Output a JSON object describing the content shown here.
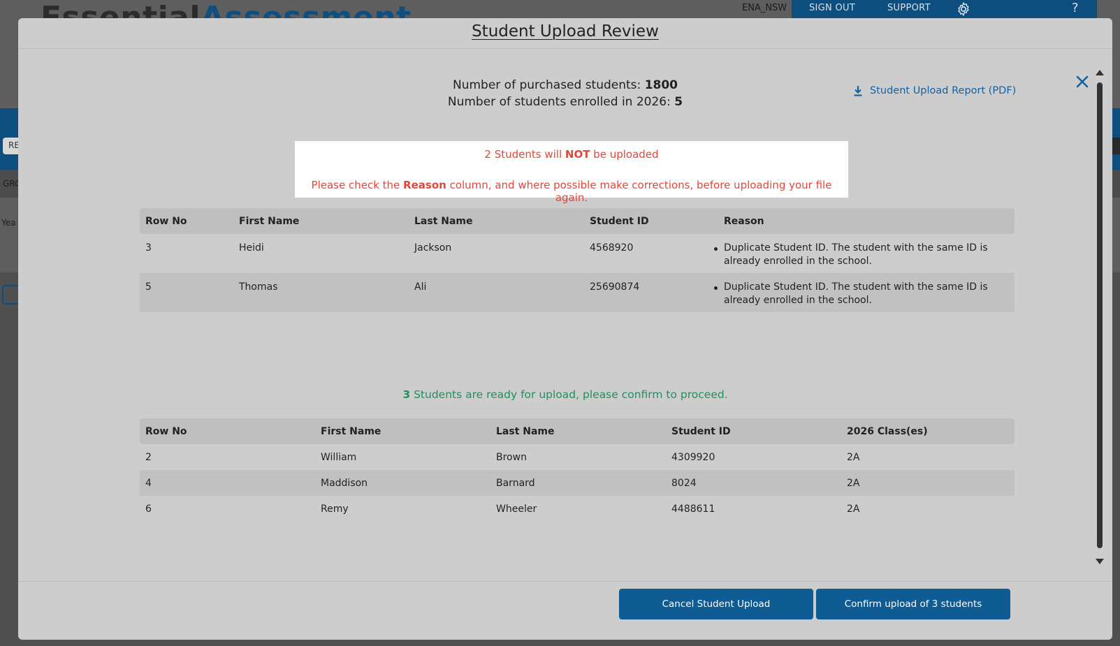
{
  "background": {
    "logo_part1": "Essential",
    "logo_part2": "Assessment",
    "user": "ENA_NSW",
    "nav_sign_out": "SIGN OUT",
    "nav_support": "SUPPORT",
    "nav_help": "?",
    "tab_re": "RE",
    "label_grc": "GRC",
    "label_yea": "Yea"
  },
  "modal": {
    "title": "Student Upload Review",
    "report_link": "Student Upload Report (PDF)",
    "purchased_label": "Number of purchased students:",
    "purchased_value": "1800",
    "enrolled_label": "Number of students enrolled in 2026:",
    "enrolled_value": "5",
    "warning": {
      "count": "2",
      "pre": " Students will ",
      "not": "NOT",
      "post": " be uploaded",
      "line2_pre": "Please check the ",
      "line2_bold": "Reason",
      "line2_post": " column, and where possible make corrections, before uploading your file again."
    },
    "rejected_table": {
      "headers": [
        "Row No",
        "First Name",
        "Last Name",
        "Student ID",
        "Reason"
      ],
      "rows": [
        {
          "row_no": "3",
          "first": "Heidi",
          "last": "Jackson",
          "id": "4568920",
          "reason": "Duplicate Student ID. The student with the same ID is already enrolled in the school."
        },
        {
          "row_no": "5",
          "first": "Thomas",
          "last": "Ali",
          "id": "25690874",
          "reason": "Duplicate Student ID. The student with the same ID is already enrolled in the school."
        }
      ]
    },
    "ready": {
      "count": "3",
      "text": " Students are ready for upload, please confirm to proceed."
    },
    "ready_table": {
      "headers": [
        "Row No",
        "First Name",
        "Last Name",
        "Student ID",
        "2026 Class(es)"
      ],
      "rows": [
        {
          "row_no": "2",
          "first": "William",
          "last": "Brown",
          "id": "4309920",
          "cls": "2A"
        },
        {
          "row_no": "4",
          "first": "Maddison",
          "last": "Barnard",
          "id": "8024",
          "cls": "2A"
        },
        {
          "row_no": "6",
          "first": "Remy",
          "last": "Wheeler",
          "id": "4488611",
          "cls": "2A"
        }
      ]
    },
    "buttons": {
      "cancel": "Cancel Student Upload",
      "confirm": "Confirm upload of 3 students"
    }
  },
  "colors": {
    "accent": "#0f5b94",
    "error": "#e0473a",
    "success": "#1e9160"
  }
}
